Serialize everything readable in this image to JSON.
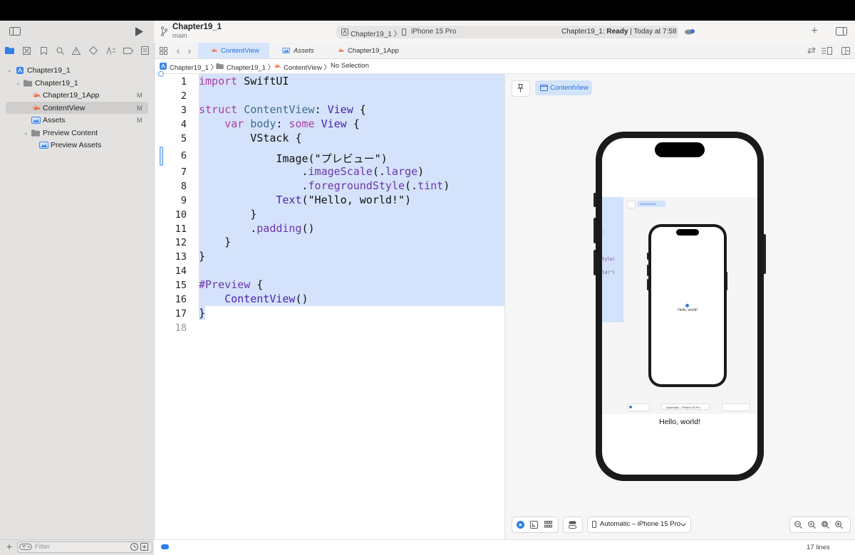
{
  "toolbar": {
    "project_title": "Chapter19_1",
    "branch": "main",
    "scheme": "Chapter19_1 〉",
    "device": "iPhone 15 Pro",
    "status_project": "Chapter19_1: ",
    "status_state": "Ready",
    "status_time": " | Today at 7:58"
  },
  "navigator": {
    "items": [
      {
        "label": "Chapter19_1",
        "badge": ""
      },
      {
        "label": "Chapter19_1",
        "badge": ""
      },
      {
        "label": "Chapter19_1App",
        "badge": "M"
      },
      {
        "label": "ContentView",
        "badge": "M"
      },
      {
        "label": "Assets",
        "badge": "M"
      },
      {
        "label": "Preview Content",
        "badge": ""
      },
      {
        "label": "Preview Assets",
        "badge": ""
      }
    ],
    "filter_placeholder": "Filter"
  },
  "tabs": [
    {
      "label": "ContentView"
    },
    {
      "label": "Assets"
    },
    {
      "label": "Chapter19_1App"
    }
  ],
  "jumpbar": {
    "crumbs": [
      "Chapter19_1",
      "Chapter19_1",
      "ContentView",
      "No Selection"
    ]
  },
  "editor": {
    "line_numbers": [
      "1",
      "2",
      "3",
      "4",
      "5",
      "6",
      "7",
      "8",
      "9",
      "10",
      "11",
      "12",
      "13",
      "14",
      "15",
      "16",
      "17",
      "18"
    ],
    "lines": {
      "l1_kw": "import",
      "l1_rest": " SwiftUI",
      "l3_kw": "struct",
      "l3_name": " ContentView",
      "l3_colon": ": ",
      "l3_type": "View",
      "l3_brace": " {",
      "l4_indent": "    ",
      "l4_kw": "var",
      "l4_name": " body",
      "l4_colon": ": ",
      "l4_some": "some",
      "l4_space": " ",
      "l4_type": "View",
      "l4_brace": " {",
      "l5": "        VStack {",
      "l6": "            Image(\"プレビュー\")",
      "l7_indent": "                .",
      "l7_method": "imageScale",
      "l7_open": "(.",
      "l7_arg": "large",
      "l7_close": ")",
      "l8_indent": "                .",
      "l8_method": "foregroundStyle",
      "l8_open": "(.",
      "l8_arg": "tint",
      "l8_close": ")",
      "l9_indent": "            ",
      "l9_type": "Text",
      "l9_rest": "(\"Hello, world!\")",
      "l10": "        }",
      "l11_indent": "        .",
      "l11_method": "padding",
      "l11_rest": "()",
      "l12": "    }",
      "l13": "}",
      "l15_kw": "#Preview",
      "l15_rest": " {",
      "l16_indent": "    ",
      "l16_type": "ContentView",
      "l16_rest": "()",
      "l17": "}"
    }
  },
  "preview": {
    "pill_label": "ContentView",
    "hello_text": "Hello, world!",
    "nested_hello": "Hello, world!",
    "nested_pill": "ContentView",
    "nested_device": "Automatic – iPhone 15 Pro",
    "nested_code_1": ":",
    "nested_code_2": "tyle(",
    "nested_code_3": "ld!\")",
    "device_select": "Automatic – iPhone 15 Pro"
  },
  "status": {
    "lines_count": "17 lines"
  },
  "colors": {
    "accent": "#2f7fe6",
    "selection": "#d4e3fb",
    "keyword": "#ad3da4",
    "type": "#4b21b0"
  }
}
